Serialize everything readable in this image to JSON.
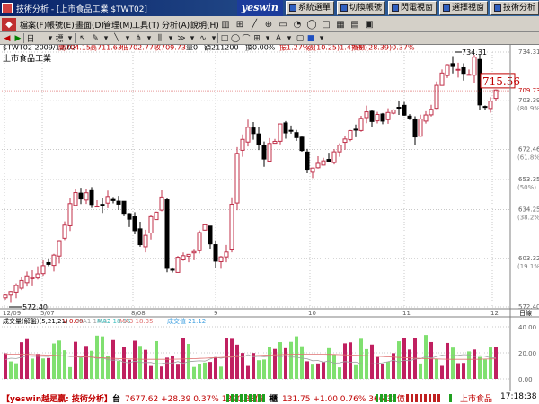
{
  "window": {
    "title": "技術分析 - [上市食品工業 $TWT02]",
    "brand": "yeswin",
    "task_buttons": [
      "系統選單",
      "切換帳號",
      "閃電視窗",
      "選擇視窗",
      "技術分析"
    ]
  },
  "menu": {
    "items": [
      "檔案(F)",
      "帳號(E)",
      "畫面(D)",
      "管理(M)",
      "工具(T)",
      "分析(A)",
      "說明(H)"
    ]
  },
  "toolbar": {
    "period": "日",
    "sizer": "標"
  },
  "chart": {
    "security_name": "上市食品工業",
    "info_line": {
      "code_date": "$TWT02 2009/12/02",
      "open": "開704.15",
      "high": "高711.63",
      "low": "低702.77",
      "close": "收709.73",
      "qty": "量0",
      "amount": "額211200",
      "turnover": "換0.00%",
      "change_pct": "振1.27%",
      "change": "漲(10.25)1.47%",
      "index": "指數(28.39)0.37%"
    },
    "price_high_label": "734.31",
    "price_low_label": "572.40",
    "cursor_price": "715.56",
    "y_axis": [
      {
        "price": "734.31",
        "pct": ""
      },
      {
        "price": "709.73",
        "pct": ""
      },
      {
        "price": "703.39",
        "pct": "(80.9%)"
      },
      {
        "price": "672.46",
        "pct": "(61.8%)"
      },
      {
        "price": "653.35",
        "pct": "(50%)"
      },
      {
        "price": "634.25",
        "pct": "(38.2%)"
      },
      {
        "price": "603.32",
        "pct": "(19.1%)"
      },
      {
        "price": "572.40",
        "pct": ""
      }
    ],
    "x_axis": [
      "12/09",
      "5/07",
      "8/08",
      "9",
      "10",
      "11",
      "12"
    ],
    "period_label": "日線",
    "volume_legend": {
      "title": "成交量(解盤)(5,21,21)",
      "v": "V 0.00",
      "ma1": "MA1 14.33",
      "ma2": "MA2 18.35",
      "ma3": "MA3 18.35",
      "value": "成交值 21.12"
    },
    "volume_axis": [
      "40.00",
      "20.00",
      "0.00"
    ]
  },
  "chart_data": {
    "type": "candlestick",
    "title": "上市食品工業",
    "ylim": [
      572.4,
      734.31
    ],
    "fib_levels": [
      0.809,
      0.618,
      0.5,
      0.382,
      0.191
    ],
    "volume_max": 40
  },
  "statusbar": {
    "brand": "【yeswin越是贏: 技術分析】",
    "tai_label": "台",
    "tai": "7677.62 +28.39 0.37% 1390.83億",
    "gui_label": "櫃",
    "gui": "131.75 +1.00 0.76% 366.32億",
    "task": "上市食品",
    "time": "17:18:38"
  },
  "colors": {
    "up": "#c0304a",
    "down": "#000000",
    "vol_up": "#c02060",
    "vol_down": "#80e070",
    "grid": "#c8c8c8"
  }
}
